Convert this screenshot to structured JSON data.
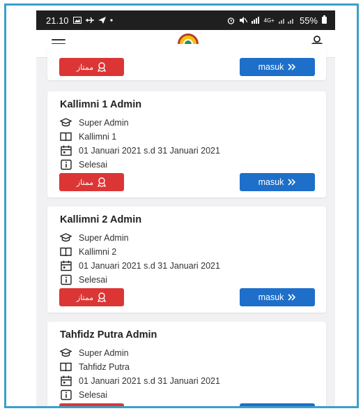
{
  "statusbar": {
    "time": "21.10",
    "signal_extra": "4G+",
    "battery": "55%"
  },
  "appbar": {
    "menu_icon": "hamburger-icon",
    "logo_icon": "app-logo",
    "user_icon": "user-icon"
  },
  "buttons": {
    "mumtaz_label": "ممتاز",
    "masuk_label": "masuk"
  },
  "cards": [
    {
      "title": "",
      "role": "",
      "program": "",
      "period": "",
      "status": ""
    },
    {
      "title": "Kallimni 1 Admin",
      "role": "Super Admin",
      "program": "Kallimni 1",
      "period": "01 Januari 2021 s.d 31 Januari 2021",
      "status": "Selesai"
    },
    {
      "title": "Kallimni 2 Admin",
      "role": "Super Admin",
      "program": "Kallimni 2",
      "period": "01 Januari 2021 s.d 31 Januari 2021",
      "status": "Selesai"
    },
    {
      "title": "Tahfidz Putra Admin",
      "role": "Super Admin",
      "program": "Tahfidz Putra",
      "period": "01 Januari 2021 s.d 31 Januari 2021",
      "status": "Selesai"
    }
  ],
  "colors": {
    "frame_border": "#3aa0c8",
    "mumtaz_button": "#dc3535",
    "masuk_button": "#1e6fc9",
    "background": "#f1f1f3"
  }
}
